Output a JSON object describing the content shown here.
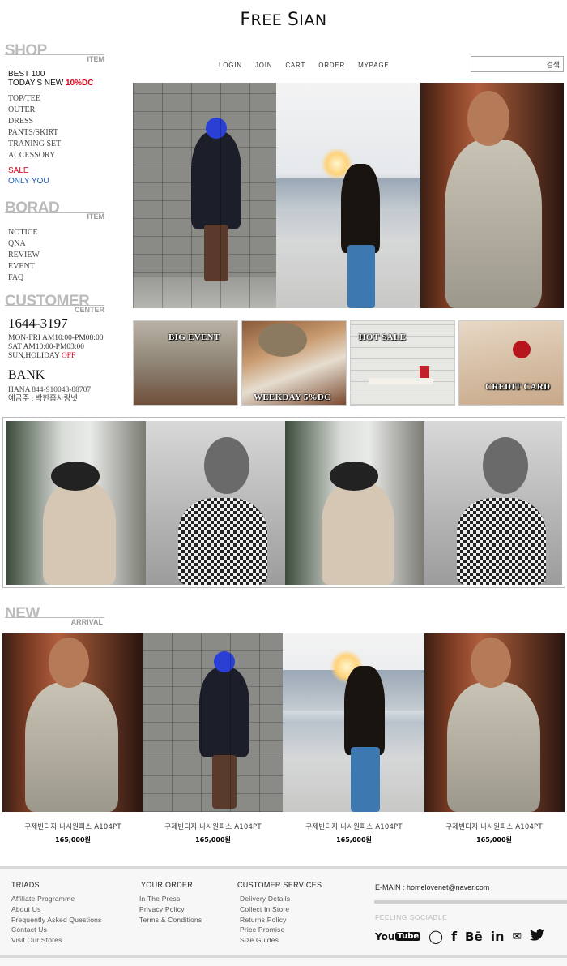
{
  "logo": {
    "first_letter": "F",
    "first_rest": "REE ",
    "second_letter": "S",
    "second_rest": "IAN"
  },
  "nav": {
    "items": [
      "LOGIN",
      "JOIN",
      "CART",
      "ORDER",
      "MYPAGE"
    ]
  },
  "search": {
    "button": "검색",
    "placeholder": ""
  },
  "shop": {
    "title": "SHOP",
    "sub": "ITEM",
    "best": "BEST 100",
    "todays_new": "TODAY'S NEW ",
    "todays_new_dc": "10%DC",
    "categories": [
      "TOP/TEE",
      "OUTER",
      "DRESS",
      "PANTS/SKIRT",
      "TRANING SET",
      "ACCESSORY"
    ],
    "sale": "SALE",
    "only_you": "ONLY YOU"
  },
  "board": {
    "title": "BORAD",
    "sub": "ITEM",
    "items": [
      "NOTICE",
      "QNA",
      "REVIEW",
      "EVENT",
      "FAQ"
    ]
  },
  "customer": {
    "title": "CUSTOMER",
    "sub": "CENTER",
    "phone": "1644-3197",
    "hours1": "MON-FRI AM10:00-PM08:00",
    "hours2": "SAT AM10:00-PM03:00",
    "hours3": "SUN,HOLIDAY ",
    "hours3_off": "OFF"
  },
  "bank": {
    "title": "BANK",
    "account": "HANA 844-910048-88707",
    "holder": "예금주 : 박한흡사랑넷"
  },
  "banners": [
    "BIG EVENT",
    "WEEKDAY 5%DC",
    "HOT SALE",
    "CREDIT CARD"
  ],
  "new_arrival": {
    "title": "NEW",
    "sub": "ARRIVAL",
    "products": [
      {
        "name": "구제빈티지 나시원피스 A104PT",
        "price": "165,000원"
      },
      {
        "name": "구제빈티지 나시원피스 A104PT",
        "price": "165,000원"
      },
      {
        "name": "구제빈티지 나시원피스 A104PT",
        "price": "165,000원"
      },
      {
        "name": "구제빈티지 나시원피스 A104PT",
        "price": "165,000원"
      }
    ]
  },
  "footer": {
    "col1": {
      "title": "TRIADS",
      "items": [
        "Affiliate Programme",
        "About Us",
        "Frequently Asked Questions",
        "Contact Us",
        "Visit Our Stores"
      ]
    },
    "col2": {
      "title": "YOUR ORDER",
      "items": [
        "In The Press",
        "Privacy Policy",
        "Terms & Conditions"
      ]
    },
    "col3": {
      "title": "CUSTOMER SERVICES",
      "items": [
        "Delivery Details",
        "Collect In Store",
        "Returns Policy",
        "Price Promise",
        "Size Guides"
      ]
    },
    "email": "E-MAIN : homelovenet@naver.com",
    "sociable": "FEELING SOCIABLE",
    "social_icons": [
      "youtube-icon",
      "chat-icon",
      "facebook-icon",
      "behance-icon",
      "linkedin-icon",
      "mail-icon",
      "twitter-icon"
    ],
    "social_glyphs": [
      "You",
      "◯",
      "f",
      "Bē",
      "in",
      "✉",
      "🐦"
    ]
  }
}
